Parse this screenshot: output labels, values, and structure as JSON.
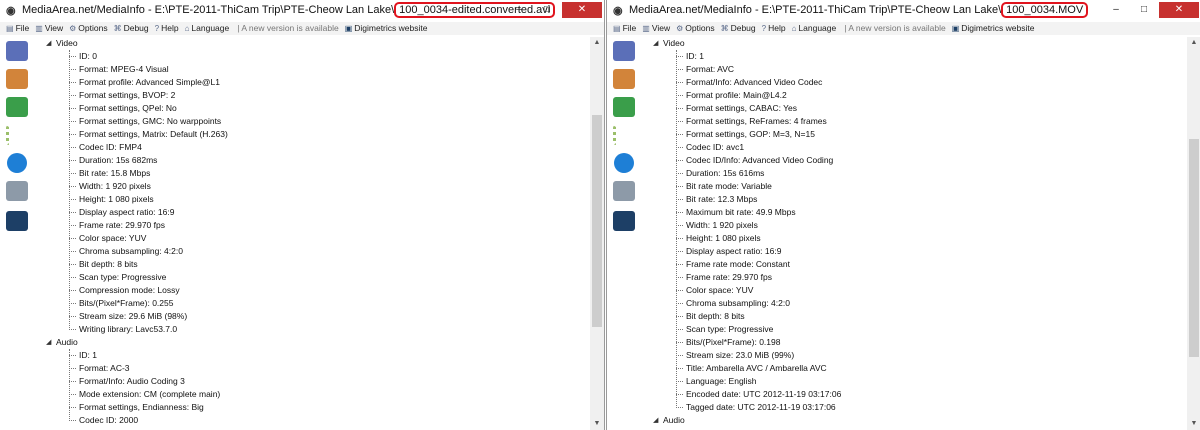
{
  "windows": [
    {
      "title_prefix": "MediaArea.net/MediaInfo - E:\\PTE-2011-ThiCam Trip\\PTE-Cheow Lan Lake\\",
      "title_file": "100_0034-edited.converted.avi",
      "menu": [
        "File",
        "View",
        "Options",
        "Debug",
        "Help",
        "Language"
      ],
      "notice": "| A new version is available",
      "website": "Digimetrics website",
      "tree": [
        {
          "section": "Video",
          "items": [
            "ID: 0",
            "Format: MPEG-4 Visual",
            "Format profile: Advanced Simple@L1",
            "Format settings, BVOP: 2",
            "Format settings, QPel: No",
            "Format settings, GMC: No warppoints",
            "Format settings, Matrix: Default (H.263)",
            "Codec ID: FMP4",
            "Duration: 15s 682ms",
            "Bit rate: 15.8 Mbps",
            "Width: 1 920 pixels",
            "Height: 1 080 pixels",
            "Display aspect ratio: 16:9",
            "Frame rate: 29.970 fps",
            "Color space: YUV",
            "Chroma subsampling: 4:2:0",
            "Bit depth: 8 bits",
            "Scan type: Progressive",
            "Compression mode: Lossy",
            "Bits/(Pixel*Frame): 0.255",
            "Stream size: 29.6 MiB (98%)",
            "Writing library: Lavc53.7.0"
          ]
        },
        {
          "section": "Audio",
          "items": [
            "ID: 1",
            "Format: AC-3",
            "Format/Info: Audio Coding 3",
            "Mode extension: CM (complete main)",
            "Format settings, Endianness: Big",
            "Codec ID: 2000"
          ]
        }
      ]
    },
    {
      "title_prefix": "MediaArea.net/MediaInfo - E:\\PTE-2011-ThiCam Trip\\PTE-Cheow Lan Lake\\",
      "title_file": "100_0034.MOV",
      "menu": [
        "File",
        "View",
        "Options",
        "Debug",
        "Help",
        "Language"
      ],
      "notice": "| A new version is available",
      "website": "Digimetrics website",
      "tree": [
        {
          "section": "Video",
          "items": [
            "ID: 1",
            "Format: AVC",
            "Format/Info: Advanced Video Codec",
            "Format profile: Main@L4.2",
            "Format settings, CABAC: Yes",
            "Format settings, ReFrames: 4 frames",
            "Format settings, GOP: M=3, N=15",
            "Codec ID: avc1",
            "Codec ID/Info: Advanced Video Coding",
            "Duration: 15s 616ms",
            "Bit rate mode: Variable",
            "Bit rate: 12.3 Mbps",
            "Maximum bit rate: 49.9 Mbps",
            "Width: 1 920 pixels",
            "Height: 1 080 pixels",
            "Display aspect ratio: 16:9",
            "Frame rate mode: Constant",
            "Frame rate: 29.970 fps",
            "Color space: YUV",
            "Chroma subsampling: 4:2:0",
            "Bit depth: 8 bits",
            "Scan type: Progressive",
            "Bits/(Pixel*Frame): 0.198",
            "Stream size: 23.0 MiB (99%)",
            "Title: Ambarella AVC / Ambarella AVC",
            "Language: English",
            "Encoded date: UTC 2012-11-19 03:17:06",
            "Tagged date: UTC 2012-11-19 03:17:06"
          ]
        },
        {
          "section": "Audio",
          "items": []
        }
      ]
    }
  ],
  "colors": {
    "title_highlight": "#e0141e",
    "close_button": "#c7312f",
    "menubar": "#f3f3f3"
  },
  "toolbar_icons": [
    "open-file-icon",
    "export-icon",
    "info-arrow-icon",
    "settings-icon",
    "about-icon",
    "compare-icon",
    "waveform-icon"
  ]
}
